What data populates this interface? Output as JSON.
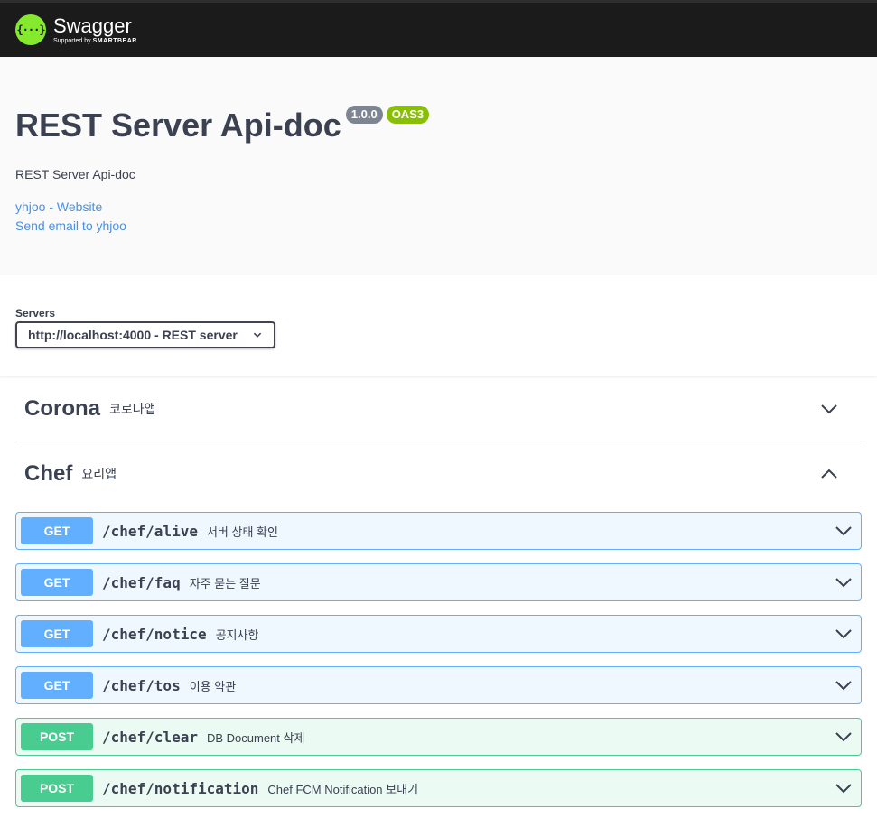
{
  "topbar": {
    "logo_mark": "{···}",
    "logo_name": "Swagger",
    "logo_sub_prefix": "Supported by",
    "logo_sub_brand": "SMARTBEAR"
  },
  "info": {
    "title": "REST Server Api-doc",
    "version_badge": "1.0.0",
    "oas_badge": "OAS3",
    "description": "REST Server Api-doc",
    "website_link": "yhjoo - Website",
    "email_link": "Send email to yhjoo"
  },
  "servers": {
    "label": "Servers",
    "selected": "http://localhost:4000 - REST server"
  },
  "tags": [
    {
      "name": "Corona",
      "description": "코로나앱",
      "expanded": false
    },
    {
      "name": "Chef",
      "description": "요리앱",
      "expanded": true
    }
  ],
  "operations": [
    {
      "method": "GET",
      "path": "/chef/alive",
      "summary": "서버 상태 확인"
    },
    {
      "method": "GET",
      "path": "/chef/faq",
      "summary": "자주 묻는 질문"
    },
    {
      "method": "GET",
      "path": "/chef/notice",
      "summary": "공지사항"
    },
    {
      "method": "GET",
      "path": "/chef/tos",
      "summary": "이용 약관"
    },
    {
      "method": "POST",
      "path": "/chef/clear",
      "summary": "DB Document 삭제"
    },
    {
      "method": "POST",
      "path": "/chef/notification",
      "summary": "Chef FCM Notification 보내기"
    }
  ],
  "colors": {
    "get": "#61affe",
    "post": "#49cc90",
    "logo_green": "#85ea2d",
    "link": "#4990e2"
  }
}
